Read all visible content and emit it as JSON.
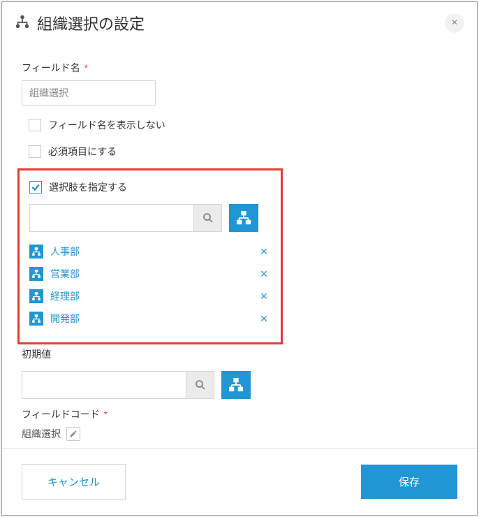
{
  "dialog": {
    "title": "組織選択の設定"
  },
  "fieldName": {
    "label": "フィールド名",
    "value": "組織選択"
  },
  "checkboxes": {
    "hideName": {
      "label": "フィールド名を表示しない",
      "checked": false
    },
    "required": {
      "label": "必須項目にする",
      "checked": false
    },
    "specify": {
      "label": "選択肢を指定する",
      "checked": true
    }
  },
  "selectedOrgs": [
    {
      "name": "人事部"
    },
    {
      "name": "営業部"
    },
    {
      "name": "経理部"
    },
    {
      "name": "開発部"
    }
  ],
  "defaultValue": {
    "label": "初期値"
  },
  "fieldCode": {
    "label": "フィールドコード",
    "value": "組織選択"
  },
  "buttons": {
    "cancel": "キャンセル",
    "save": "保存"
  }
}
